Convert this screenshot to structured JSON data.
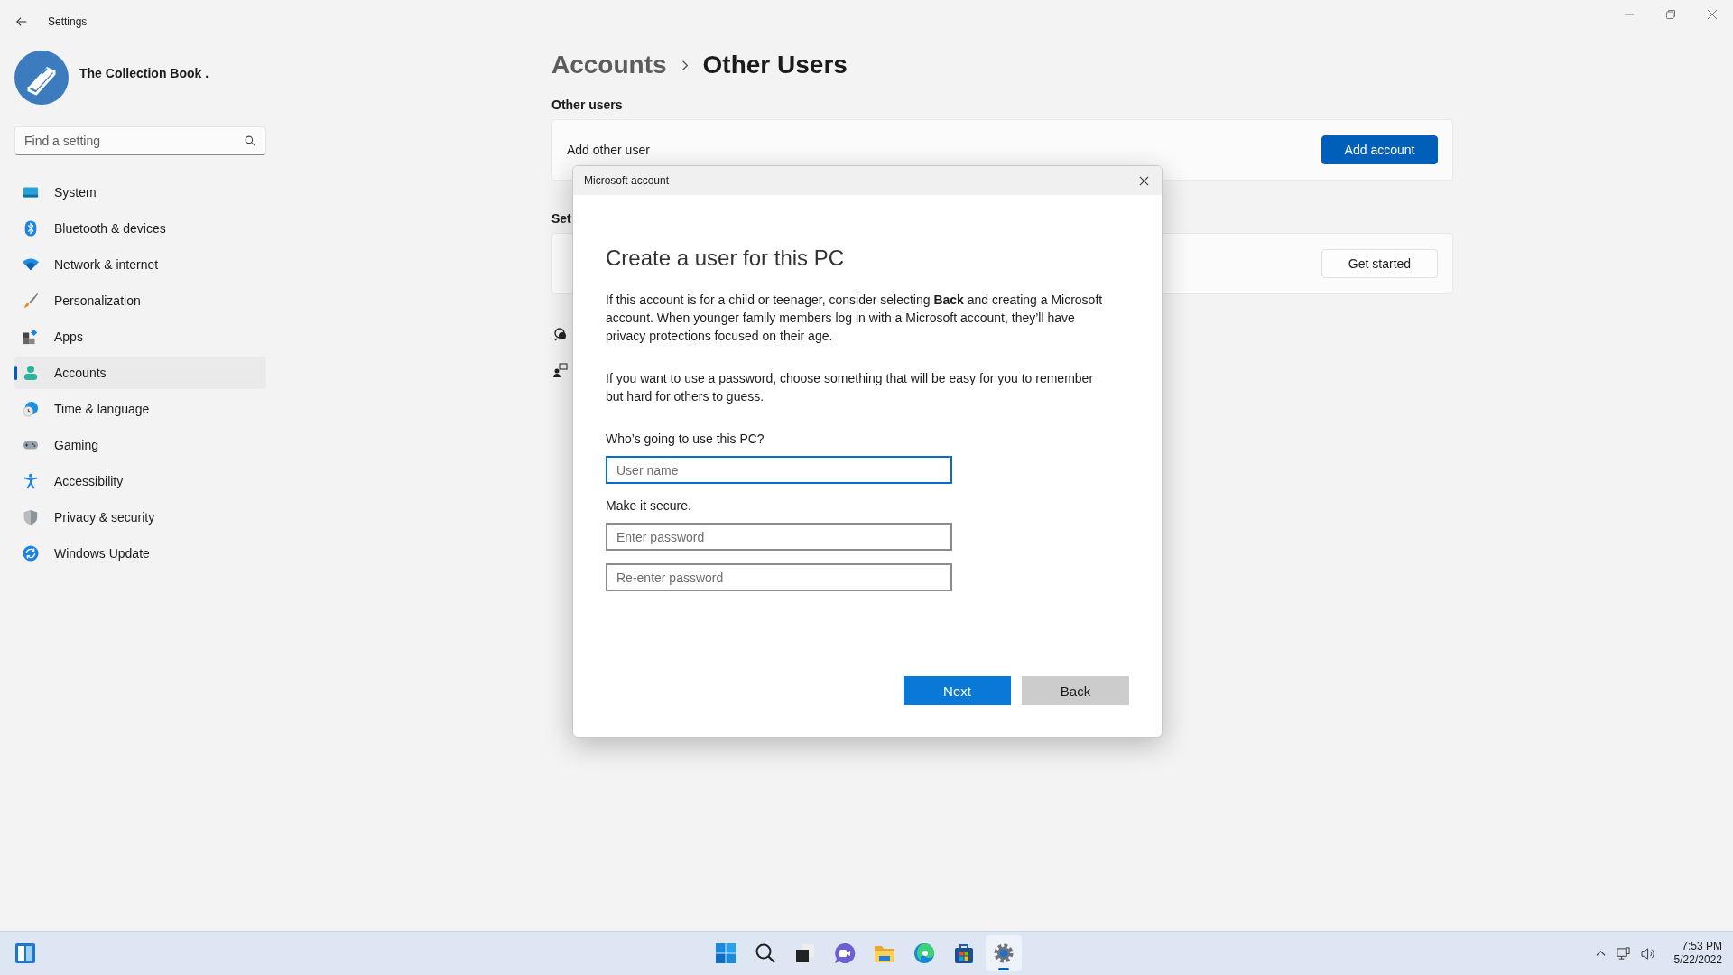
{
  "window": {
    "title": "Settings"
  },
  "profile": {
    "name": "The Collection Book ."
  },
  "search": {
    "placeholder": "Find a setting"
  },
  "nav": [
    {
      "label": "System",
      "kind": "system",
      "selected": false
    },
    {
      "label": "Bluetooth & devices",
      "kind": "bluetooth",
      "selected": false
    },
    {
      "label": "Network & internet",
      "kind": "network",
      "selected": false
    },
    {
      "label": "Personalization",
      "kind": "personalization",
      "selected": false
    },
    {
      "label": "Apps",
      "kind": "apps",
      "selected": false
    },
    {
      "label": "Accounts",
      "kind": "accounts",
      "selected": true
    },
    {
      "label": "Time & language",
      "kind": "time",
      "selected": false
    },
    {
      "label": "Gaming",
      "kind": "gaming",
      "selected": false
    },
    {
      "label": "Accessibility",
      "kind": "accessibility",
      "selected": false
    },
    {
      "label": "Privacy & security",
      "kind": "privacy",
      "selected": false
    },
    {
      "label": "Windows Update",
      "kind": "update",
      "selected": false
    }
  ],
  "breadcrumb": {
    "parent": "Accounts",
    "current": "Other Users"
  },
  "sections": [
    {
      "heading": "Other users",
      "label": "Add other user",
      "button": {
        "label": "Add account",
        "primary": true
      }
    },
    {
      "heading": "Set",
      "button": {
        "label": "Get started",
        "primary": false
      }
    }
  ],
  "dialog": {
    "title": "Microsoft account",
    "heading": "Create a user for this PC",
    "paragraphs": [
      "If this account is for a child or teenager, consider selecting **Back** and creating a Microsoft account. When younger family members log in with a Microsoft account, they’ll have privacy protections focused on their age.",
      "If you want to use a password, choose something that will be easy for you to remember but hard for others to guess."
    ],
    "groups": [
      {
        "label": "Who’s going to use this PC?",
        "fields": [
          {
            "placeholder": "User name",
            "focused": true
          }
        ]
      },
      {
        "label": "Make it secure.",
        "fields": [
          {
            "placeholder": "Enter password",
            "focused": false
          },
          {
            "placeholder": "Re-enter password",
            "focused": false
          }
        ]
      }
    ],
    "buttons": [
      {
        "label": "Next",
        "primary": true
      },
      {
        "label": "Back",
        "primary": false
      }
    ]
  },
  "taskbar": {
    "apps": [
      {
        "kind": "start",
        "active": false
      },
      {
        "kind": "search",
        "active": false
      },
      {
        "kind": "taskview",
        "active": false
      },
      {
        "kind": "chat",
        "active": false
      },
      {
        "kind": "explorer",
        "active": false
      },
      {
        "kind": "edge",
        "active": false
      },
      {
        "kind": "store",
        "active": false
      },
      {
        "kind": "settings",
        "active": true
      }
    ],
    "clock": {
      "time": "7:53 PM",
      "date": "5/22/2022"
    }
  }
}
